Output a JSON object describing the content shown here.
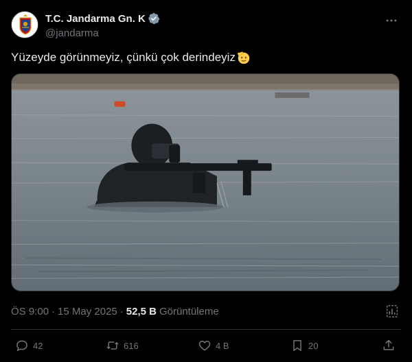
{
  "author": {
    "display_name": "T.C. Jandarma Gn. K",
    "handle": "@jandarma",
    "verified_icon": "verified-badge-icon",
    "avatar_icon": "gendarmerie-emblem-icon"
  },
  "tweet": {
    "text": "Yüzeyde görünmeyiz, çünkü çok derindeyiz",
    "emoji_icon": "saluting-face-emoji",
    "media_icon": "photo-soldier-in-water"
  },
  "meta": {
    "time": "ÖS 9:00",
    "separator": "·",
    "date": "15 May 2025",
    "views_count": "52,5 B",
    "views_label": "Görüntüleme"
  },
  "actions": {
    "replies": "42",
    "reposts": "616",
    "likes": "4 B",
    "bookmarks": "20"
  },
  "colors": {
    "background": "#000000",
    "text_primary": "#e7e9ea",
    "text_secondary": "#71767b",
    "verified": "#829aab",
    "divider": "#2f3336"
  }
}
